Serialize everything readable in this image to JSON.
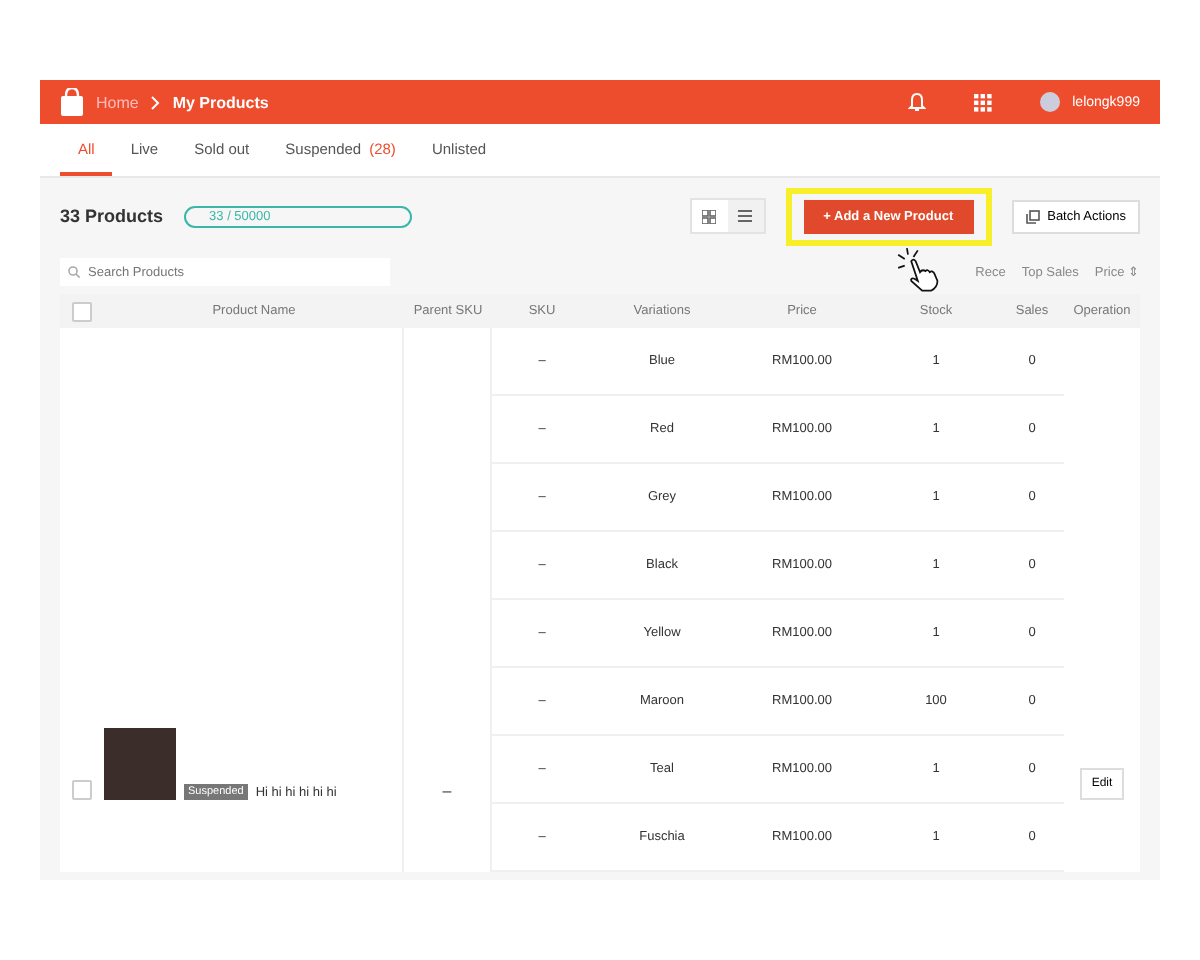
{
  "header": {
    "breadcrumb": [
      "Home",
      "My Products"
    ],
    "username": "lelongk999"
  },
  "tabs": [
    {
      "label": "All",
      "selected": true
    },
    {
      "label": "Live",
      "selected": false
    },
    {
      "label": "Sold out",
      "selected": false
    },
    {
      "label": "Suspended",
      "count": "(28)",
      "selected": false
    },
    {
      "label": "Unlisted",
      "selected": false
    }
  ],
  "toolbar": {
    "title": "33 Products",
    "quota": "33 / 50000",
    "add_button": "+ Add a New Product",
    "batch_button": "Batch Actions"
  },
  "search": {
    "placeholder": "Search Products"
  },
  "sort_options": [
    "Rece",
    "Top Sales",
    "Price ⇕"
  ],
  "table": {
    "columns": [
      "Product Name",
      "Parent SKU",
      "SKU",
      "Variations",
      "Price",
      "Stock",
      "Sales",
      "Operation"
    ],
    "select_all": {
      "checked": false
    },
    "product": {
      "checked": false,
      "tag": "Suspended",
      "name": "Hi hi hi hi hi hi",
      "parent_sku": "–",
      "operation": "Edit"
    },
    "variations": [
      {
        "sku": "–",
        "variation": "Blue",
        "price": "RM100.00",
        "stock": "1",
        "sales": "0"
      },
      {
        "sku": "–",
        "variation": "Red",
        "price": "RM100.00",
        "stock": "1",
        "sales": "0"
      },
      {
        "sku": "–",
        "variation": "Grey",
        "price": "RM100.00",
        "stock": "1",
        "sales": "0"
      },
      {
        "sku": "–",
        "variation": "Black",
        "price": "RM100.00",
        "stock": "1",
        "sales": "0"
      },
      {
        "sku": "–",
        "variation": "Yellow",
        "price": "RM100.00",
        "stock": "1",
        "sales": "0"
      },
      {
        "sku": "–",
        "variation": "Maroon",
        "price": "RM100.00",
        "stock": "100",
        "sales": "0"
      },
      {
        "sku": "–",
        "variation": "Teal",
        "price": "RM100.00",
        "stock": "1",
        "sales": "0"
      },
      {
        "sku": "–",
        "variation": "Fuschia",
        "price": "RM100.00",
        "stock": "1",
        "sales": "0"
      }
    ]
  }
}
